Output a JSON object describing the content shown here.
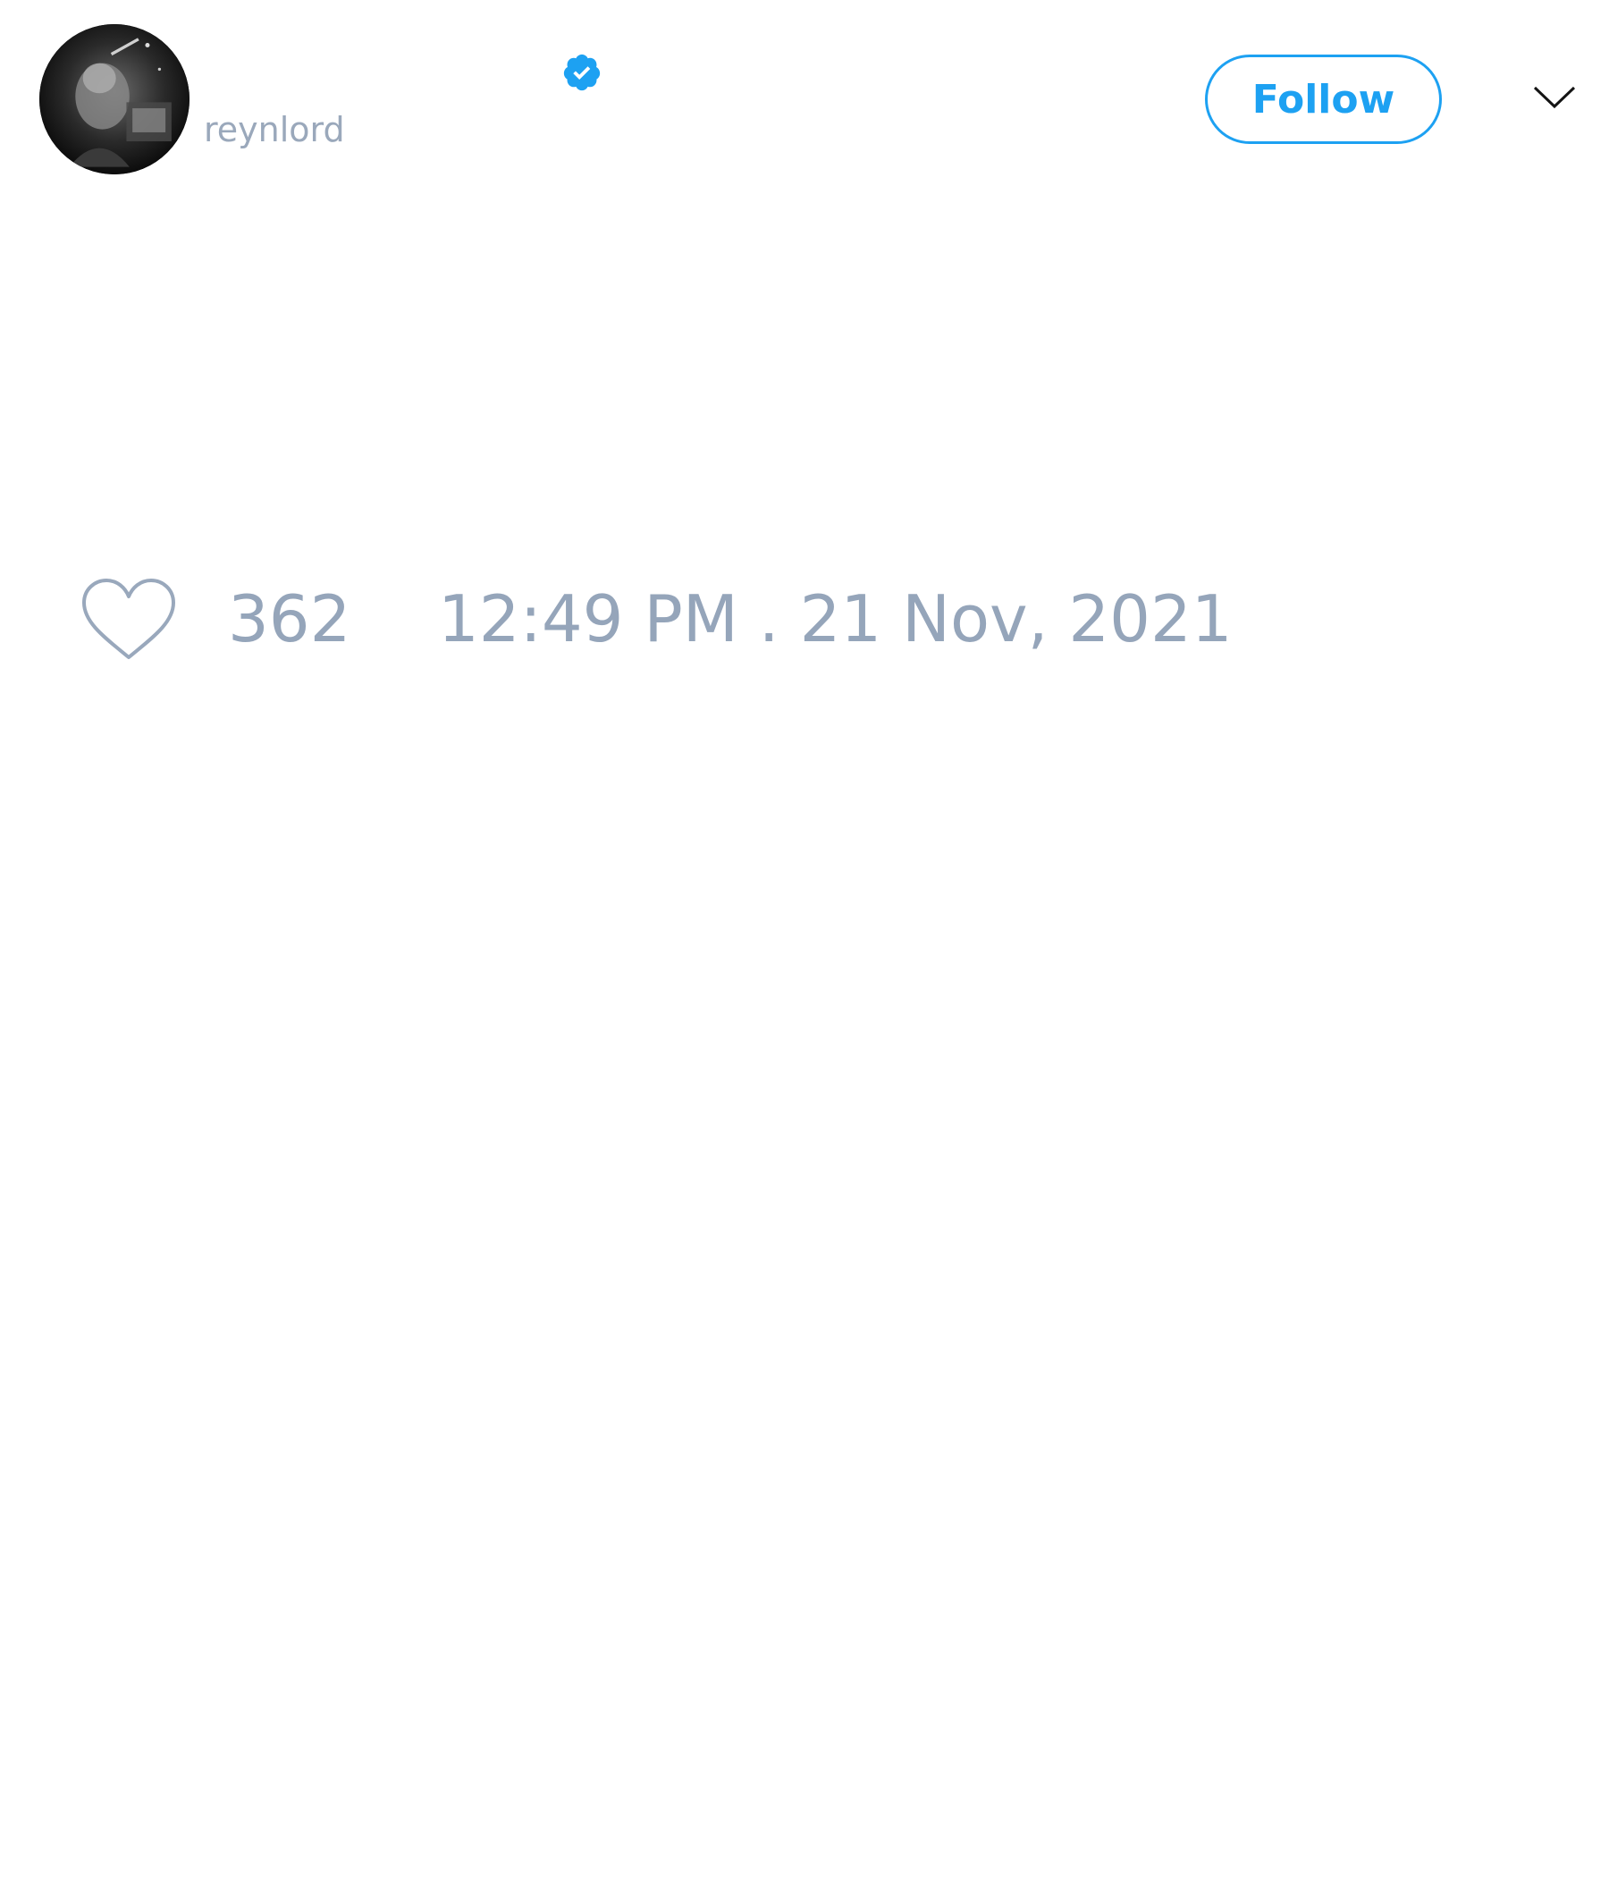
{
  "tweet": {
    "author": {
      "handle": "reynlord",
      "verified": true,
      "avatar_icon": "avatar-photo"
    },
    "header": {
      "follow_label": "Follow",
      "menu_icon": "chevron-down-icon"
    },
    "engagement": {
      "like_icon": "heart-icon",
      "like_count": "362",
      "timestamp": "12:49 PM . 21 Nov, 2021"
    }
  },
  "colors": {
    "accent": "#1da1f2",
    "muted_text": "#95a5ba",
    "background": "#ffffff"
  }
}
